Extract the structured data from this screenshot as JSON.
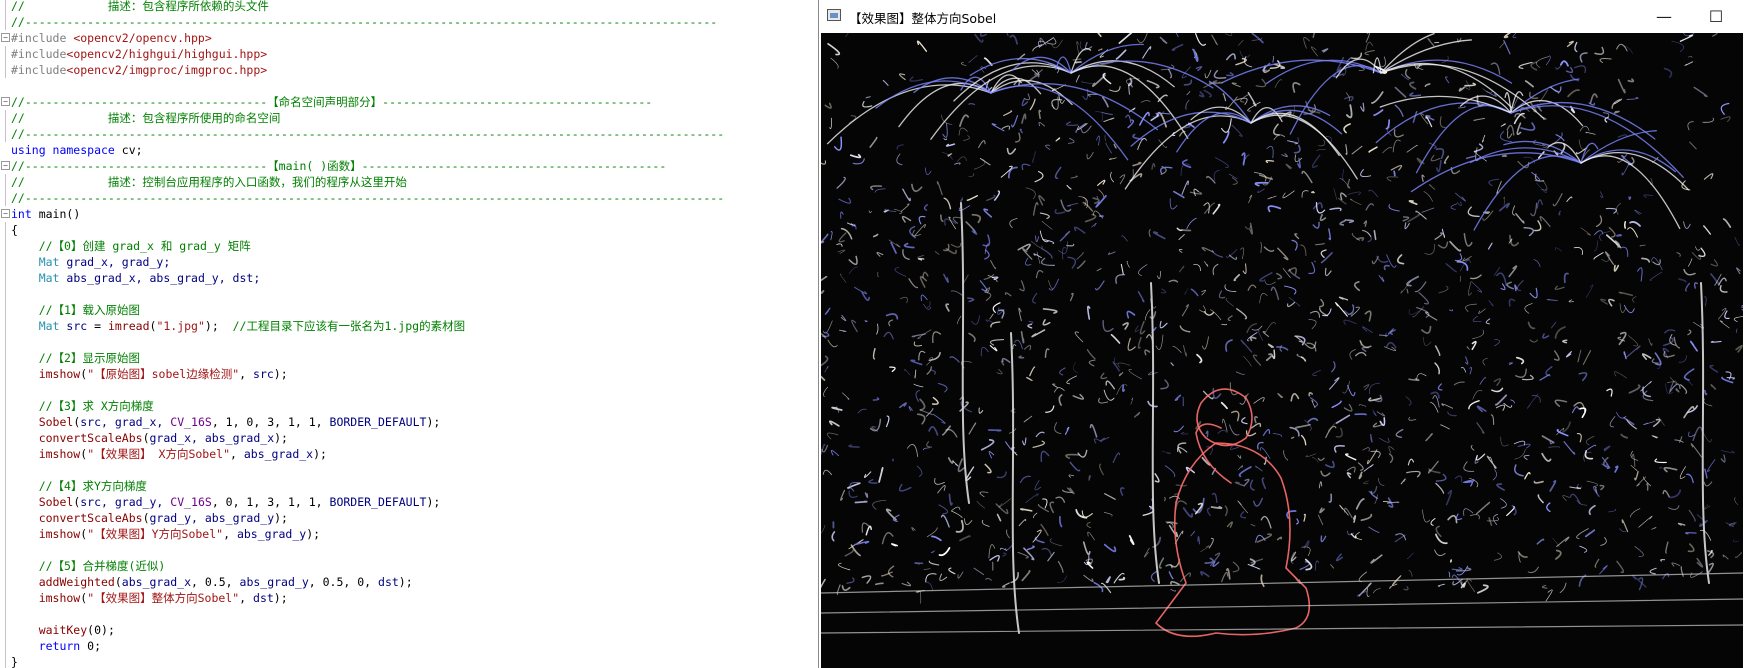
{
  "editor": {
    "lines": [
      {
        "fold": "",
        "guide": true,
        "parts": [
          [
            "c-comment",
            "//            描述：包含程序所依赖的头文件"
          ]
        ]
      },
      {
        "fold": "",
        "guide": true,
        "parts": [
          [
            "c-comment",
            "//----------------------------------------------------------------------------------------------------"
          ]
        ]
      },
      {
        "fold": "−",
        "guide": false,
        "parts": [
          [
            "c-pre",
            "#include "
          ],
          [
            "c-str",
            "<opencv2/opencv.hpp>"
          ]
        ]
      },
      {
        "fold": "",
        "guide": true,
        "parts": [
          [
            "c-pre",
            "#include"
          ],
          [
            "c-str",
            "<opencv2/highgui/highgui.hpp>"
          ]
        ]
      },
      {
        "fold": "",
        "guide": true,
        "parts": [
          [
            "c-pre",
            "#include"
          ],
          [
            "c-str",
            "<opencv2/imgproc/imgproc.hpp>"
          ]
        ]
      },
      {
        "fold": "",
        "guide": false,
        "parts": []
      },
      {
        "fold": "−",
        "guide": false,
        "parts": [
          [
            "c-comment",
            "//-----------------------------------【命名空间声明部分】---------------------------------------"
          ]
        ]
      },
      {
        "fold": "",
        "guide": true,
        "parts": [
          [
            "c-comment",
            "//            描述：包含程序所使用的命名空间"
          ]
        ]
      },
      {
        "fold": "",
        "guide": true,
        "parts": [
          [
            "c-comment",
            "//-----------------------------------------------------------------------------------------------------"
          ]
        ]
      },
      {
        "fold": "",
        "guide": false,
        "parts": [
          [
            "c-kw",
            "using namespace "
          ],
          [
            "",
            "cv;"
          ]
        ]
      },
      {
        "fold": "−",
        "guide": false,
        "parts": [
          [
            "c-comment",
            "//-----------------------------------【main( )函数】--------------------------------------------"
          ]
        ]
      },
      {
        "fold": "",
        "guide": true,
        "parts": [
          [
            "c-comment",
            "//            描述：控制台应用程序的入口函数，我们的程序从这里开始"
          ]
        ]
      },
      {
        "fold": "",
        "guide": true,
        "parts": [
          [
            "c-comment",
            "//-----------------------------------------------------------------------------------------------------"
          ]
        ]
      },
      {
        "fold": "−",
        "guide": false,
        "parts": [
          [
            "c-kw",
            "int "
          ],
          [
            "",
            "main()"
          ]
        ]
      },
      {
        "fold": "",
        "guide": true,
        "parts": [
          [
            "",
            "{"
          ]
        ]
      },
      {
        "fold": "",
        "guide": true,
        "parts": [
          [
            "c-comment",
            "    //【0】创建 grad_x 和 grad_y 矩阵"
          ]
        ]
      },
      {
        "fold": "",
        "guide": true,
        "parts": [
          [
            "c-type",
            "    Mat "
          ],
          [
            "c-var",
            "grad_x, grad_y;"
          ]
        ]
      },
      {
        "fold": "",
        "guide": true,
        "parts": [
          [
            "c-type",
            "    Mat "
          ],
          [
            "c-var",
            "abs_grad_x, abs_grad_y, dst;"
          ]
        ]
      },
      {
        "fold": "",
        "guide": true,
        "parts": []
      },
      {
        "fold": "",
        "guide": true,
        "parts": [
          [
            "c-comment",
            "    //【1】载入原始图"
          ]
        ]
      },
      {
        "fold": "",
        "guide": true,
        "parts": [
          [
            "c-type",
            "    Mat "
          ],
          [
            "c-var",
            "src"
          ],
          [
            "",
            " = "
          ],
          [
            "c-fn",
            "imread"
          ],
          [
            "",
            "("
          ],
          [
            "c-str",
            "\"1.jpg\""
          ],
          [
            "",
            ");  "
          ],
          [
            "c-comment",
            "//工程目录下应该有一张名为1.jpg的素材图"
          ]
        ]
      },
      {
        "fold": "",
        "guide": true,
        "parts": []
      },
      {
        "fold": "",
        "guide": true,
        "parts": [
          [
            "c-comment",
            "    //【2】显示原始图"
          ]
        ]
      },
      {
        "fold": "",
        "guide": true,
        "parts": [
          [
            "c-fn",
            "    imshow"
          ],
          [
            "",
            "("
          ],
          [
            "c-str",
            "\"【原始图】sobel边缘检测\""
          ],
          [
            "",
            ", "
          ],
          [
            "c-var",
            "src"
          ],
          [
            "",
            ");"
          ]
        ]
      },
      {
        "fold": "",
        "guide": true,
        "parts": []
      },
      {
        "fold": "",
        "guide": true,
        "parts": [
          [
            "c-comment",
            "    //【3】求 X方向梯度"
          ]
        ]
      },
      {
        "fold": "",
        "guide": true,
        "parts": [
          [
            "c-fn",
            "    Sobel"
          ],
          [
            "",
            "("
          ],
          [
            "c-var",
            "src, grad_x, "
          ],
          [
            "c-macro",
            "CV_16S"
          ],
          [
            "",
            ", 1, 0, 3, 1, 1, "
          ],
          [
            "c-var",
            "BORDER_DEFAULT"
          ],
          [
            "",
            ");"
          ]
        ]
      },
      {
        "fold": "",
        "guide": true,
        "parts": [
          [
            "c-fn",
            "    convertScaleAbs"
          ],
          [
            "",
            "("
          ],
          [
            "c-var",
            "grad_x, abs_grad_x"
          ],
          [
            "",
            ");"
          ]
        ]
      },
      {
        "fold": "",
        "guide": true,
        "parts": [
          [
            "c-fn",
            "    imshow"
          ],
          [
            "",
            "("
          ],
          [
            "c-str",
            "\"【效果图】 X方向Sobel\""
          ],
          [
            "",
            ", "
          ],
          [
            "c-var",
            "abs_grad_x"
          ],
          [
            "",
            ");"
          ]
        ]
      },
      {
        "fold": "",
        "guide": true,
        "parts": []
      },
      {
        "fold": "",
        "guide": true,
        "parts": [
          [
            "c-comment",
            "    //【4】求Y方向梯度"
          ]
        ]
      },
      {
        "fold": "",
        "guide": true,
        "parts": [
          [
            "c-fn",
            "    Sobel"
          ],
          [
            "",
            "("
          ],
          [
            "c-var",
            "src, grad_y, "
          ],
          [
            "c-macro",
            "CV_16S"
          ],
          [
            "",
            ", 0, 1, 3, 1, 1, "
          ],
          [
            "c-var",
            "BORDER_DEFAULT"
          ],
          [
            "",
            ");"
          ]
        ]
      },
      {
        "fold": "",
        "guide": true,
        "parts": [
          [
            "c-fn",
            "    convertScaleAbs"
          ],
          [
            "",
            "("
          ],
          [
            "c-var",
            "grad_y, abs_grad_y"
          ],
          [
            "",
            ");"
          ]
        ]
      },
      {
        "fold": "",
        "guide": true,
        "parts": [
          [
            "c-fn",
            "    imshow"
          ],
          [
            "",
            "("
          ],
          [
            "c-str",
            "\"【效果图】Y方向Sobel\""
          ],
          [
            "",
            ", "
          ],
          [
            "c-var",
            "abs_grad_y"
          ],
          [
            "",
            ");"
          ]
        ]
      },
      {
        "fold": "",
        "guide": true,
        "parts": []
      },
      {
        "fold": "",
        "guide": true,
        "parts": [
          [
            "c-comment",
            "    //【5】合并梯度(近似)"
          ]
        ]
      },
      {
        "fold": "",
        "guide": true,
        "parts": [
          [
            "c-fn",
            "    addWeighted"
          ],
          [
            "",
            "("
          ],
          [
            "c-var",
            "abs_grad_x"
          ],
          [
            "",
            ", 0.5, "
          ],
          [
            "c-var",
            "abs_grad_y"
          ],
          [
            "",
            ", 0.5, 0, "
          ],
          [
            "c-var",
            "dst"
          ],
          [
            "",
            ");"
          ]
        ]
      },
      {
        "fold": "",
        "guide": true,
        "parts": [
          [
            "c-fn",
            "    imshow"
          ],
          [
            "",
            "("
          ],
          [
            "c-str",
            "\"【效果图】整体方向Sobel\""
          ],
          [
            "",
            ", "
          ],
          [
            "c-var",
            "dst"
          ],
          [
            "",
            ");"
          ]
        ]
      },
      {
        "fold": "",
        "guide": true,
        "parts": []
      },
      {
        "fold": "",
        "guide": true,
        "parts": [
          [
            "c-fn",
            "    waitKey"
          ],
          [
            "",
            "(0);"
          ]
        ]
      },
      {
        "fold": "",
        "guide": true,
        "parts": [
          [
            "c-kw",
            "    return "
          ],
          [
            "",
            "0;"
          ]
        ]
      },
      {
        "fold": "",
        "guide": true,
        "parts": [
          [
            "",
            "}"
          ]
        ]
      }
    ]
  },
  "image_window": {
    "title": "【效果图】整体方向Sobel",
    "minimize_glyph": "—",
    "maximize_glyph": "☐",
    "icon": "window-app-icon"
  }
}
